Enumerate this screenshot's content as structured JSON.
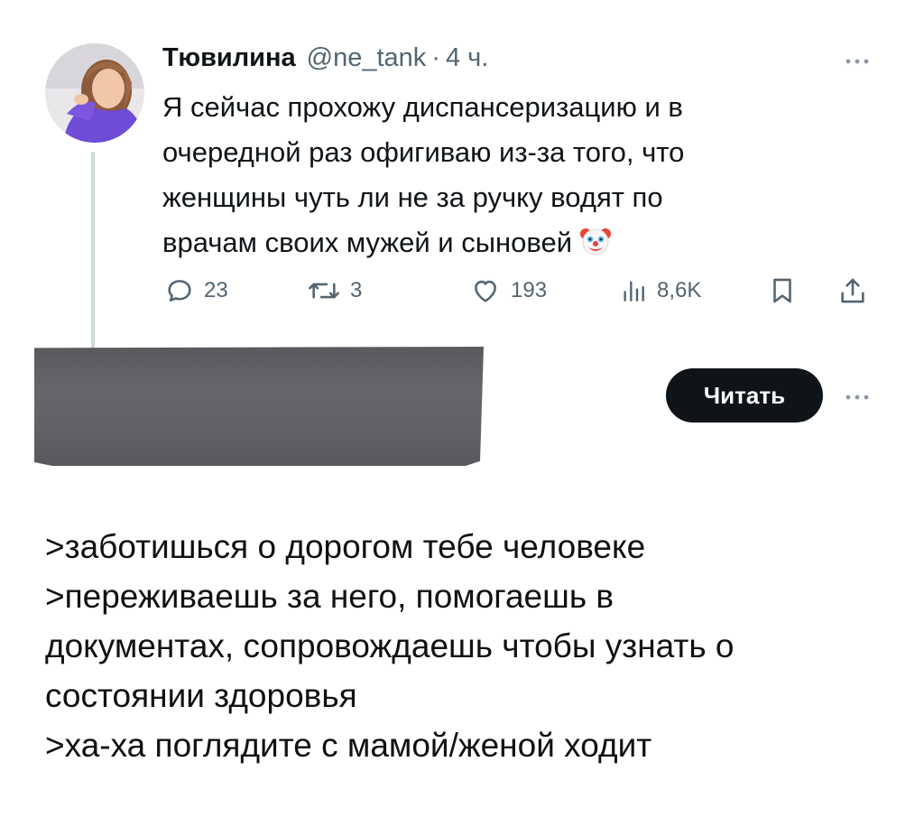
{
  "tweet": {
    "display_name": "Тювилина",
    "handle": "@ne_tank",
    "separator": "·",
    "time": "4 ч.",
    "text_lines": [
      "Я сейчас прохожу диспансеризацию и в",
      "очередной раз офигиваю из-за того, что",
      "женщины чуть ли не за ручку водят по",
      "врачам своих мужей и сыновей"
    ],
    "emoji": "clown-face-emoji",
    "actions": {
      "replies": "23",
      "retweets": "3",
      "likes": "193",
      "views": "8,6K"
    },
    "icons": {
      "reply": "reply-icon",
      "retweet": "retweet-icon",
      "like": "heart-icon",
      "views": "views-chart-icon",
      "bookmark": "bookmark-icon",
      "share": "share-icon",
      "more": "more-dots-icon"
    }
  },
  "read_button": {
    "label": "Читать"
  },
  "caption": {
    "lines": [
      ">заботишься о дорогом тебе человеке",
      ">переживаешь за него, помогаешь в",
      "документах, сопровождаешь чтобы узнать о",
      "состоянии здоровья",
      ">ха-ха поглядите с мамой/женой ходит"
    ]
  },
  "colors": {
    "text": "#0f1419",
    "secondary": "#536471",
    "thread_line": "#cfd9de",
    "button_bg": "#0f1419",
    "button_text": "#ffffff",
    "redaction": "#616165"
  }
}
